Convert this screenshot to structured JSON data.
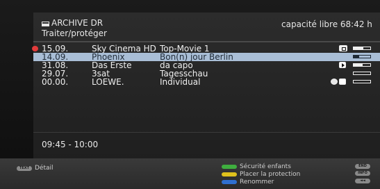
{
  "header": {
    "folder_label": "ARCHIVE DR",
    "subtitle": "Traiter/protéger",
    "capacity": "capacité libre 68:42 h"
  },
  "recordings": [
    {
      "date": "15.09.",
      "channel": "Sky Cinema HD",
      "title": "Top-Movie 1",
      "locked": true,
      "icons": [
        "lock-badge-icon"
      ],
      "progress": 0.6,
      "selected": false
    },
    {
      "date": "14.09.",
      "channel": "Phoenix",
      "title": "Bon(n) jour Berlin",
      "locked": false,
      "icons": [],
      "progress": 0.35,
      "selected": true
    },
    {
      "date": "31.08.",
      "channel": "Das Erste",
      "title": "da capo",
      "locked": false,
      "icons": [
        "play-icon"
      ],
      "progress": 0.55,
      "selected": false
    },
    {
      "date": "29.07.",
      "channel": "3sat",
      "title": "Tagesschau",
      "locked": false,
      "icons": [],
      "progress": 0.0,
      "selected": false
    },
    {
      "date": "00.00.",
      "channel": "LOEWE.",
      "title": "Individual",
      "locked": false,
      "icons": [
        "timer-icon",
        "folder-icon"
      ],
      "progress": 0.0,
      "selected": false
    }
  ],
  "time_range": "09:45 - 10:00",
  "legend": {
    "text_btn": "TEXT",
    "detail": "Détail",
    "green": "Sécurité enfants",
    "yellow": "Placer la protection",
    "blue": "Renommer",
    "end_btn": "END",
    "info_btn": "INFO",
    "back_btn": "◄◄"
  },
  "colors": {
    "selected_row": "#a9bed6",
    "green_key": "#3fae3f",
    "yellow_key": "#e0c21c",
    "blue_key": "#2f6fd0",
    "lock_red": "#e23b3b"
  }
}
